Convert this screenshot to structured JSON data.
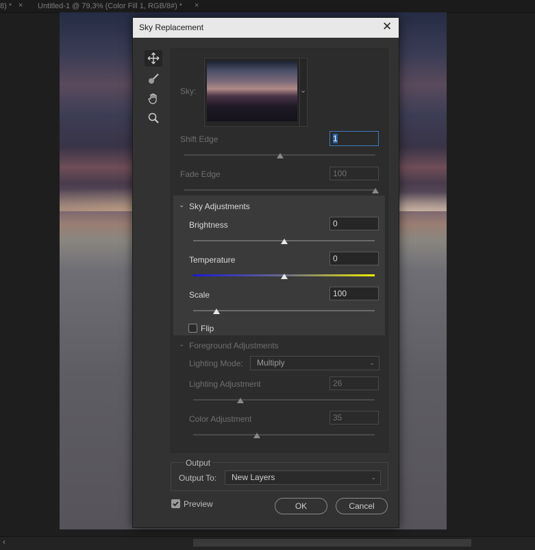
{
  "document_tabs": [
    {
      "label": "8) *",
      "close": "×"
    },
    {
      "label": "Untitled-1 @ 79,3% (Color Fill 1, RGB/8#) *",
      "close": "×"
    }
  ],
  "dialog": {
    "title": "Sky Replacement",
    "close_glyph": "✕",
    "tools": [
      "move-sky-icon",
      "sky-brush-icon",
      "hand-icon",
      "zoom-icon"
    ],
    "sky": {
      "label": "Sky:",
      "dropdown_glyph": "⌄"
    },
    "shift_edge": {
      "label": "Shift Edge",
      "value": "1",
      "slider_fraction": 0.5
    },
    "fade_edge": {
      "label": "Fade Edge",
      "value": "100",
      "slider_fraction": 1.0
    },
    "sky_adjustments": {
      "title": "Sky Adjustments",
      "brightness": {
        "label": "Brightness",
        "value": "0",
        "slider_fraction": 0.5
      },
      "temperature": {
        "label": "Temperature",
        "value": "0",
        "slider_fraction": 0.5
      },
      "scale": {
        "label": "Scale",
        "value": "100",
        "slider_fraction": 0.13
      },
      "flip": {
        "label": "Flip",
        "checked": false
      }
    },
    "foreground_adjustments": {
      "title": "Foreground Adjustments",
      "lighting_mode": {
        "label": "Lighting Mode:",
        "value": "Multiply"
      },
      "lighting_adjustment": {
        "label": "Lighting Adjustment",
        "value": "26",
        "slider_fraction": 0.26
      },
      "color_adjustment": {
        "label": "Color Adjustment",
        "value": "35",
        "slider_fraction": 0.35
      }
    },
    "output": {
      "title": "Output",
      "output_to": {
        "label": "Output To:",
        "value": "New Layers"
      }
    },
    "preview": {
      "label": "Preview",
      "checked": true
    },
    "ok_label": "OK",
    "cancel_label": "Cancel"
  },
  "colors": {
    "accent_focus": "#3e7bbd",
    "temperature_cold": "#1a1ad8",
    "temperature_warm": "#f0f000"
  },
  "scroll": {
    "left_glyph": "‹"
  }
}
